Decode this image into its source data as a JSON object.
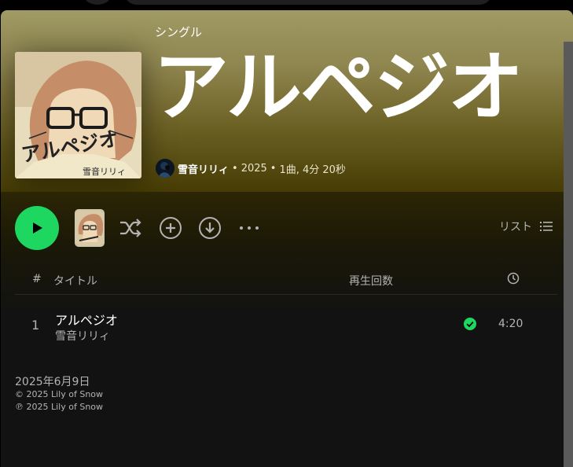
{
  "album": {
    "type_label": "シングル",
    "title": "アルペジオ",
    "cover_text": "アルペジオ",
    "cover_artist_text": "雪音リリィ",
    "artist": "雪音リリィ",
    "year": "2025",
    "summary": "1曲, 4分 20秒",
    "separator": "•"
  },
  "controls": {
    "list_label": "リスト"
  },
  "table": {
    "columns": {
      "number": "#",
      "title": "タイトル",
      "plays": "再生回数"
    },
    "tracks": [
      {
        "number": "1",
        "title": "アルペジオ",
        "artist": "雪音リリィ",
        "duration": "4:20",
        "saved": true
      }
    ]
  },
  "footer": {
    "release_date": "2025年6月9日",
    "copyright": "© 2025 Lily of Snow",
    "phonographic": "℗ 2025 Lily of Snow"
  },
  "colors": {
    "accent": "#1ed760",
    "hero_top": "#a09a64",
    "hero_bottom": "#463c04",
    "background": "#121212"
  }
}
